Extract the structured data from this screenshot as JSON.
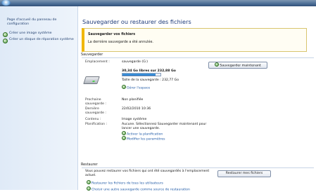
{
  "sidebar": {
    "home_link": "Page d'accueil du panneau de configuration",
    "items": [
      {
        "label": "Créer une image système",
        "icon": "shield-icon"
      },
      {
        "label": "Créer un disque de réparation système",
        "icon": "shield-icon"
      }
    ]
  },
  "page_title": "Sauvegarder ou restaurer des fichiers",
  "notice": {
    "title": "Sauvegarder vos fichiers",
    "message": "La dernière sauvegarde a été annulée."
  },
  "backup": {
    "section_title": "Sauvegarder",
    "location_label": "Emplacement :",
    "location_value": "sauvegarde (G:)",
    "used_fraction": 0.87,
    "free_text": "30,34 Go libres sur 232,88 Go",
    "backup_size": "Taille de la sauvegarde : 232,77 Go",
    "manage_space": "Gérer l'espace",
    "backup_now": "Sauvegarder maintenant",
    "next_label": "Prochaine sauvegarde :",
    "next_value": "Non planifiée",
    "last_label": "Dernière sauvegarde :",
    "last_value": "22/02/2010 10:36",
    "contents_label": "Contenu :",
    "contents_value": "Image système",
    "schedule_label": "Planification :",
    "schedule_value": "Aucune. Sélectionnez Sauvegarder maintenant pour lancer une sauvegarde.",
    "enable_schedule": "Activer la planification",
    "change_settings": "Modifier les paramètres"
  },
  "restore": {
    "section_title": "Restaurer",
    "description": "Vous pouvez restaurer vos fichiers qui ont été sauvegardés à l'emplacement actuel.",
    "restore_my_files": "Restaurer mes fichiers",
    "restore_all_users": "Restaurer les fichiers de tous les utilisateurs",
    "choose_other": "Choisir une autre sauvegarde comme source de restauration"
  },
  "colors": {
    "title": "#1e3b7a",
    "link": "#1c57a5",
    "notice_accent": "#f0b700",
    "bar_fill": "#1f6fc0"
  }
}
